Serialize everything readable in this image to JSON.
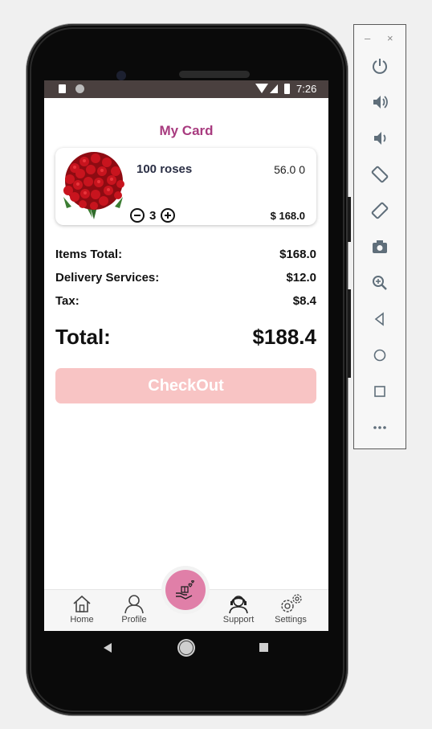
{
  "status_bar": {
    "time": "7:26"
  },
  "page": {
    "title": "My Card"
  },
  "cart_item": {
    "name": "100 roses",
    "unit_price": "56.0 0",
    "quantity": "3",
    "line_total": "$ 168.0"
  },
  "summary": {
    "items_total_label": "Items Total:",
    "items_total_value": "$168.0",
    "delivery_label": "Delivery Services:",
    "delivery_value": "$12.0",
    "tax_label": "Tax:",
    "tax_value": "$8.4",
    "total_label": "Total:",
    "total_value": "$188.4"
  },
  "checkout": {
    "label": "CheckOut"
  },
  "bottom_nav": {
    "home": "Home",
    "profile": "Profile",
    "support": "Support",
    "settings": "Settings",
    "center_icon": "gift-hand-icon"
  },
  "colors": {
    "title": "#a83b7f",
    "checkout_bg": "#f8c4c4",
    "fab": "#e07fa8",
    "status_bar": "#4a403f"
  },
  "emulator_panel": {
    "minimize": "–",
    "close": "×",
    "buttons": [
      "power-icon",
      "volume-up-icon",
      "volume-down-icon",
      "rotate-left-icon",
      "rotate-right-icon",
      "camera-icon",
      "zoom-icon",
      "back-icon",
      "home-icon",
      "overview-icon",
      "more-icon"
    ]
  }
}
